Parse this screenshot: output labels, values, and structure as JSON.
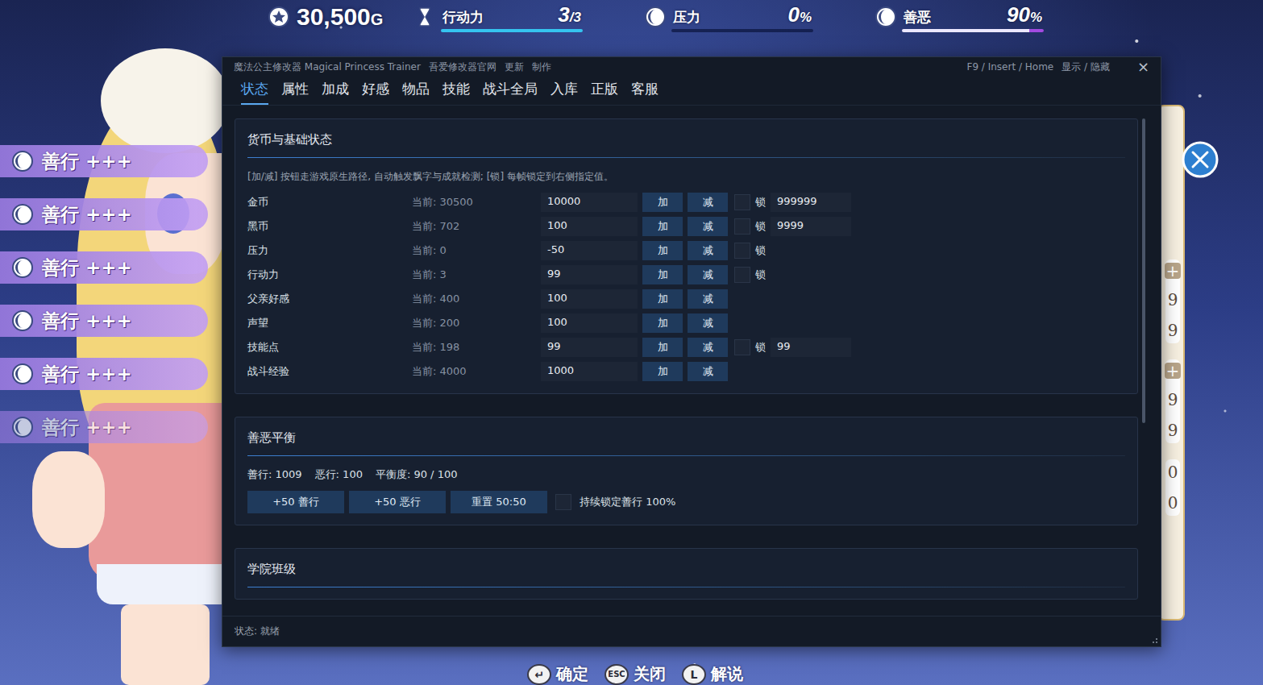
{
  "hud": {
    "gold": {
      "value": "30,500",
      "unit": "G"
    },
    "stats": [
      {
        "label": "行动力",
        "value": "3",
        "suffix": "/3",
        "level": 1,
        "color": "#35c4f0"
      },
      {
        "label": "压力",
        "value": "0",
        "suffix": "%",
        "level": 0,
        "color": "#35c4f0"
      },
      {
        "label": "善恶",
        "value": "90",
        "suffix": "%",
        "level": 0.9,
        "color": "#ece8ff"
      }
    ]
  },
  "popups": [
    {
      "label": "善行 +++",
      "fading": false
    },
    {
      "label": "善行 +++",
      "fading": false
    },
    {
      "label": "善行 +++",
      "fading": false
    },
    {
      "label": "善行 +++",
      "fading": false
    },
    {
      "label": "善行 +++",
      "fading": false
    },
    {
      "label": "善行 +++",
      "fading": true
    }
  ],
  "trainer": {
    "title": "魔法公主修改器 Magical Princess Trainer",
    "links": [
      "吾爱修改器官网",
      "更新",
      "制作"
    ],
    "hotkey": "F9 / Insert / Home",
    "toggle": "显示 / 隐藏",
    "close": "×",
    "tabs": [
      {
        "label": "状态",
        "selected": true
      },
      {
        "label": "属性",
        "selected": false
      },
      {
        "label": "加成",
        "selected": false
      },
      {
        "label": "好感",
        "selected": false
      },
      {
        "label": "物品",
        "selected": false
      },
      {
        "label": "技能",
        "selected": false
      },
      {
        "label": "战斗全局",
        "selected": false
      },
      {
        "label": "入库",
        "selected": false
      },
      {
        "label": "正版",
        "selected": false
      },
      {
        "label": "客服",
        "selected": false
      }
    ],
    "basic": {
      "title": "货币与基础状态",
      "note": "[加/减] 按钮走游戏原生路径, 自动触发飘字与成就检测; [锁] 每帧锁定到右侧指定值。",
      "rows": [
        {
          "name": "金币",
          "current": "当前: 30500",
          "input": "10000",
          "add": "加",
          "sub": "减",
          "lock": {
            "label": "锁",
            "checked": false,
            "value": "999999"
          }
        },
        {
          "name": "黑币",
          "current": "当前: 702",
          "input": "100",
          "add": "加",
          "sub": "减",
          "lock": {
            "label": "锁",
            "checked": false,
            "value": "9999"
          }
        },
        {
          "name": "压力",
          "current": "当前: 0",
          "input": "-50",
          "add": "加",
          "sub": "减",
          "lock": {
            "label": "锁",
            "checked": false,
            "value": null
          }
        },
        {
          "name": "行动力",
          "current": "当前: 3",
          "input": "99",
          "add": "加",
          "sub": "减",
          "lock": {
            "label": "锁",
            "checked": false,
            "value": null
          }
        },
        {
          "name": "父亲好感",
          "current": "当前: 400",
          "input": "100",
          "add": "加",
          "sub": "减",
          "lock": null
        },
        {
          "name": "声望",
          "current": "当前: 200",
          "input": "100",
          "add": "加",
          "sub": "减",
          "lock": null
        },
        {
          "name": "技能点",
          "current": "当前: 198",
          "input": "99",
          "add": "加",
          "sub": "减",
          "lock": {
            "label": "锁",
            "checked": false,
            "value": "99"
          }
        },
        {
          "name": "战斗经验",
          "current": "当前: 4000",
          "input": "1000",
          "add": "加",
          "sub": "减",
          "lock": null
        }
      ]
    },
    "balance": {
      "title": "善恶平衡",
      "stats": [
        "善行: 1009",
        "恶行: 100",
        "平衡度: 90 / 100"
      ],
      "buttons": [
        "+50 善行",
        "+50 恶行",
        "重置 50:50"
      ],
      "lock": {
        "label": "持续锁定善行 100%",
        "checked": false
      }
    },
    "class": {
      "title": "学院班级"
    },
    "status": "状态: 就绪"
  },
  "right_panel": [
    {
      "plus": "+",
      "digits": [
        "9",
        "9"
      ]
    },
    {
      "plus": "+",
      "digits": [
        "9",
        "9"
      ]
    },
    {
      "plus": null,
      "digits": [
        "0",
        "0"
      ]
    }
  ],
  "bottom_buttons": [
    {
      "key": "↵",
      "label": "确定"
    },
    {
      "key": "ESC",
      "label": "关闭"
    },
    {
      "key": "L",
      "label": "解说"
    }
  ]
}
